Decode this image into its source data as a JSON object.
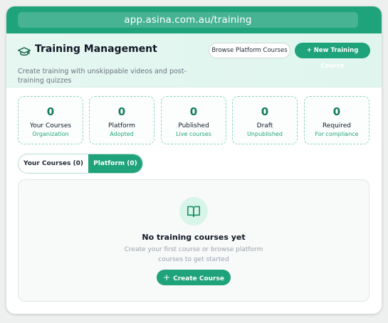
{
  "browser": {
    "url": "app.asina.com.au/training"
  },
  "header": {
    "icon": "graduation-cap-icon",
    "title": "Training Management",
    "subtitle": "Create training with unskippable videos and post-training quizzes",
    "browse_label": "Browse Platform Courses",
    "new_label": "+ New Training Course"
  },
  "stats": [
    {
      "value": "0",
      "label": "Your Courses",
      "sub": "Organization"
    },
    {
      "value": "0",
      "label": "Platform",
      "sub": "Adopted"
    },
    {
      "value": "0",
      "label": "Published",
      "sub": "Live courses"
    },
    {
      "value": "0",
      "label": "Draft",
      "sub": "Unpublished"
    },
    {
      "value": "0",
      "label": "Required",
      "sub": "For compliance"
    }
  ],
  "tabs": {
    "yours": "Your Courses (0)",
    "platform": "Platform (0)",
    "active": "platform"
  },
  "empty": {
    "icon": "book-open-icon",
    "title": "No training courses yet",
    "subtitle": "Create your first course or browse platform courses to get started",
    "button_label": "Create Course"
  },
  "colors": {
    "accent": "#1fa37a",
    "header_bg": "#e6f7f1",
    "stat_border": "#8fd6be"
  }
}
